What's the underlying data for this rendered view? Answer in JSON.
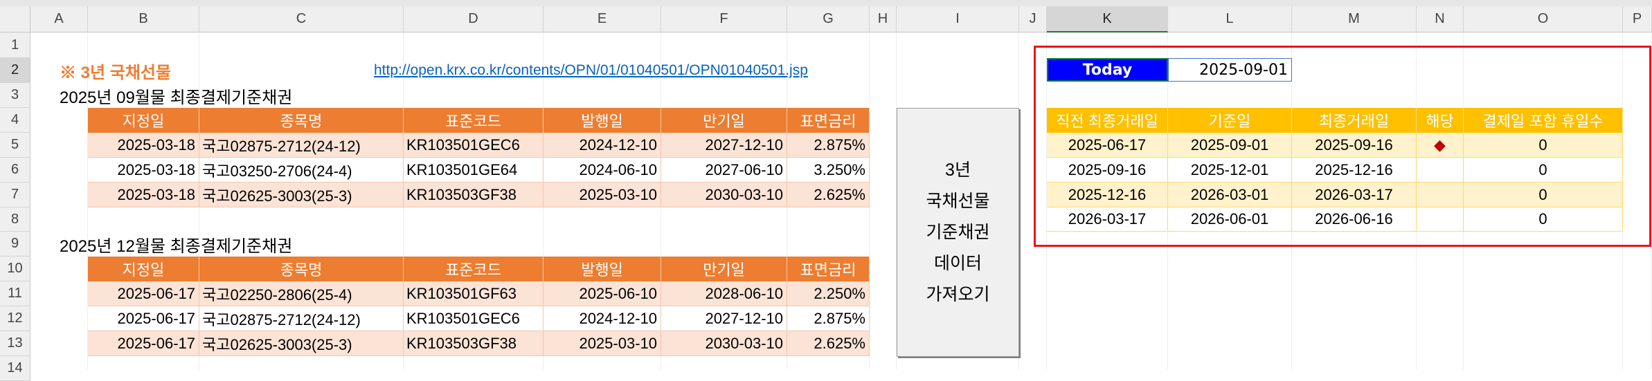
{
  "columns": [
    "A",
    "B",
    "C",
    "D",
    "E",
    "F",
    "G",
    "H",
    "I",
    "J",
    "K",
    "L",
    "M",
    "N",
    "O",
    "P"
  ],
  "rows": [
    "1",
    "2",
    "3",
    "4",
    "5",
    "6",
    "7",
    "8",
    "9",
    "10",
    "11",
    "12",
    "13",
    "14"
  ],
  "selected_column": "K",
  "selected_row": "2",
  "header_title": "※ 3년 국채선물",
  "source_link": "http://open.krx.co.kr/contents/OPN/01/01040501/OPN01040501.jsp",
  "table_headers": [
    "지정일",
    "종목명",
    "표준코드",
    "발행일",
    "만기일",
    "표면금리"
  ],
  "section1": {
    "title": "2025년 09월물 최종결제기준채권",
    "rows": [
      [
        "2025-03-18",
        "국고02875-2712(24-12)",
        "KR103501GEC6",
        "2024-12-10",
        "2027-12-10",
        "2.875%"
      ],
      [
        "2025-03-18",
        "국고03250-2706(24-4)",
        "KR103501GE64",
        "2024-06-10",
        "2027-06-10",
        "3.250%"
      ],
      [
        "2025-03-18",
        "국고02625-3003(25-3)",
        "KR103503GF38",
        "2025-03-10",
        "2030-03-10",
        "2.625%"
      ]
    ]
  },
  "section2": {
    "title": "2025년 12월물 최종결제기준채권",
    "rows": [
      [
        "2025-06-17",
        "국고02250-2806(25-4)",
        "KR103501GF63",
        "2025-06-10",
        "2028-06-10",
        "2.250%"
      ],
      [
        "2025-06-17",
        "국고02875-2712(24-12)",
        "KR103501GEC6",
        "2024-12-10",
        "2027-12-10",
        "2.875%"
      ],
      [
        "2025-06-17",
        "국고02625-3003(25-3)",
        "KR103503GF38",
        "2025-03-10",
        "2030-03-10",
        "2.625%"
      ]
    ]
  },
  "fetch_button": {
    "lines": [
      "3년",
      "국채선물",
      "기준채권",
      "데이터",
      "가져오기"
    ]
  },
  "today": {
    "label": "Today",
    "value": "2025-09-01"
  },
  "right_table": {
    "headers": [
      "직전 최종거래일",
      "기준일",
      "최종거래일",
      "해당",
      "결제일 포함 휴일수"
    ],
    "rows": [
      [
        "2025-06-17",
        "2025-09-01",
        "2025-09-16",
        "◆",
        "0"
      ],
      [
        "2025-09-16",
        "2025-12-01",
        "2025-12-16",
        "",
        "0"
      ],
      [
        "2025-12-16",
        "2026-03-01",
        "2026-03-17",
        "",
        "0"
      ],
      [
        "2026-03-17",
        "2026-06-01",
        "2026-06-16",
        "",
        "0"
      ]
    ]
  },
  "colors": {
    "orange_header": "#ed7d31",
    "orange_band": "#fbe3d6",
    "gold_header": "#ffc000",
    "gold_band": "#fff2cc",
    "today_fill": "#0000ff",
    "highlight_border": "#e8141c",
    "marker": "#c00000"
  }
}
